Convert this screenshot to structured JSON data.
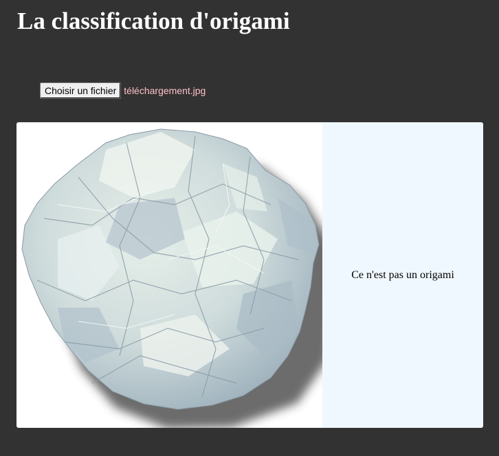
{
  "header": {
    "title": "La classification d'origami"
  },
  "upload": {
    "button_label": "Choisir un fichier",
    "file_name": "téléchargement.jpg"
  },
  "result": {
    "image_subject": "crumpled paper ball",
    "verdict": "Ce n'est pas un origami"
  },
  "colors": {
    "page_background": "#333232",
    "title_text": "#ffffff",
    "file_name_text": "#ffc0cb",
    "image_background": "#ffffff",
    "verdict_background": "#f0f8ff"
  }
}
